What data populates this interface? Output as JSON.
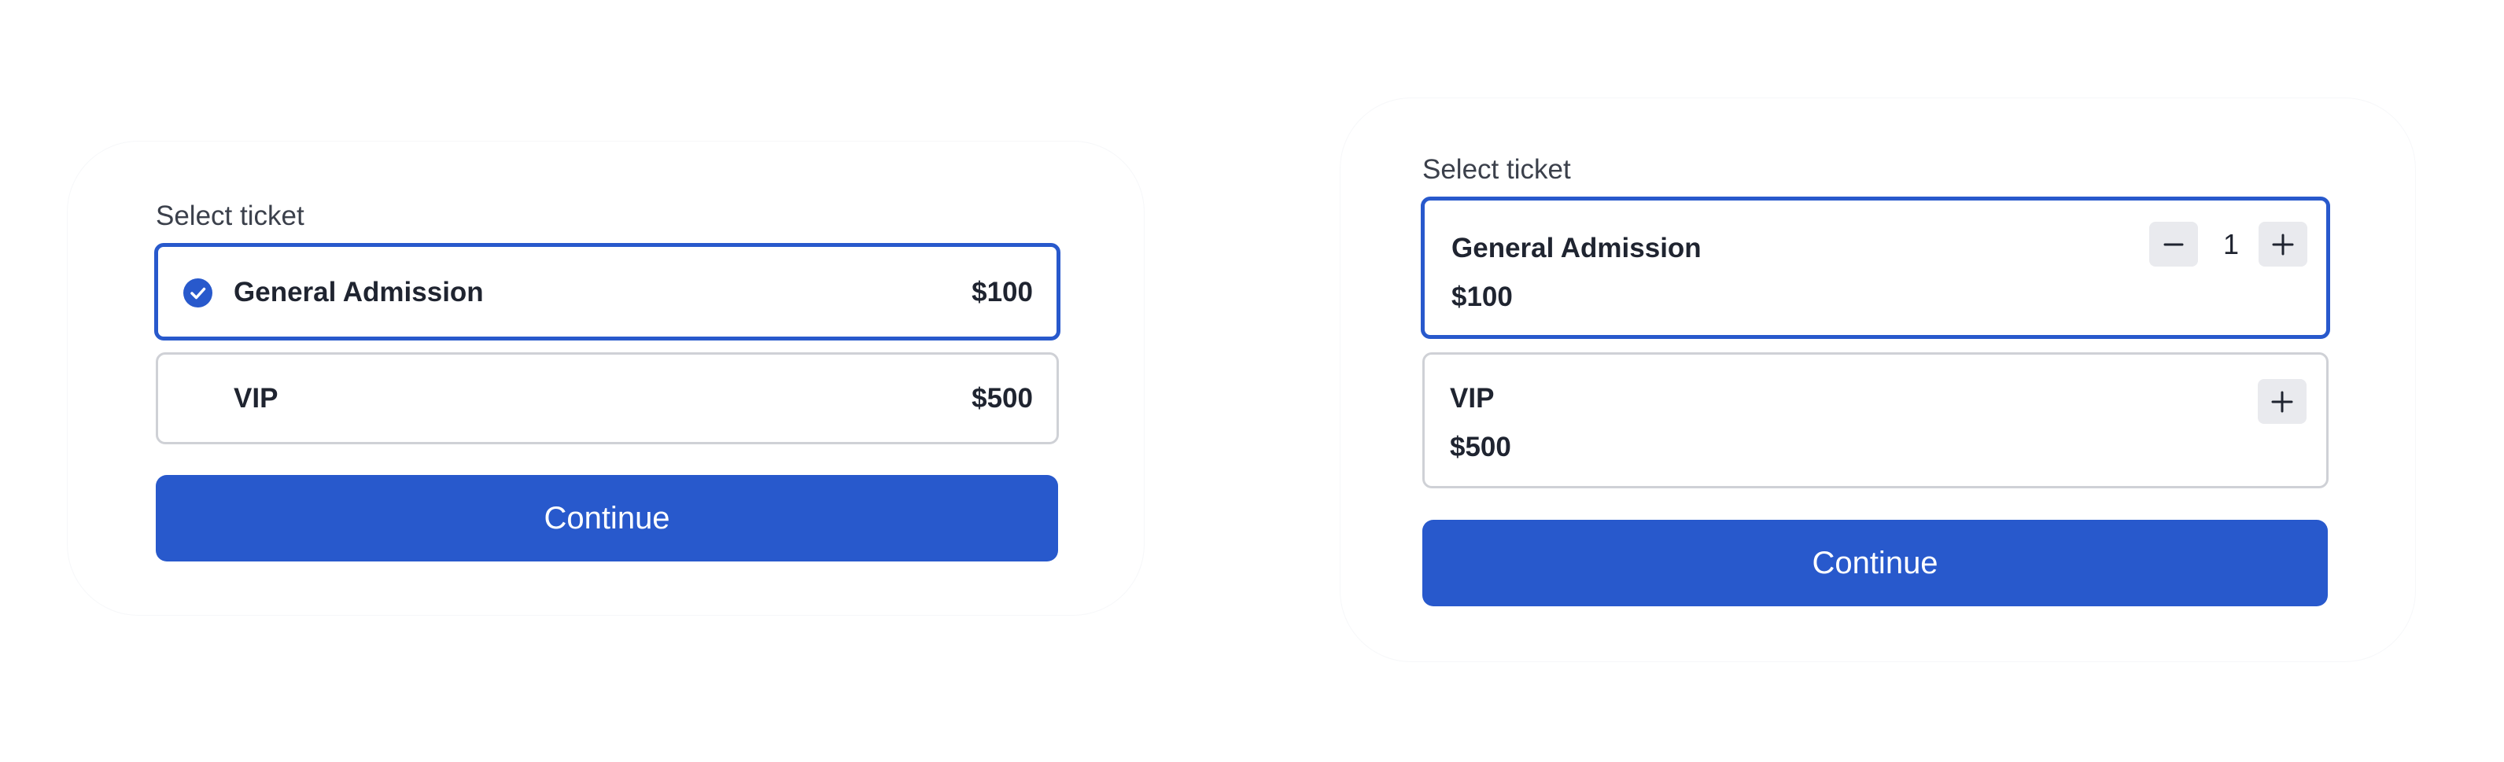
{
  "colors": {
    "accent": "#2859cc",
    "border": "#cfd1d6",
    "stepper_bg": "#e9eaee",
    "text": "#1f2430"
  },
  "variant_single": {
    "label": "Select ticket",
    "tickets": [
      {
        "name": "General Admission",
        "price": "$100",
        "selected": true,
        "icon": "check-circle-icon"
      },
      {
        "name": "VIP",
        "price": "$500",
        "selected": false
      }
    ],
    "continue_label": "Continue"
  },
  "variant_quantity": {
    "label": "Select ticket",
    "tickets": [
      {
        "name": "General Admission",
        "price": "$100",
        "selected": true,
        "quantity": "1",
        "icons": [
          "minus-icon",
          "plus-icon"
        ]
      },
      {
        "name": "VIP",
        "price": "$500",
        "selected": false,
        "icons": [
          "plus-icon"
        ]
      }
    ],
    "continue_label": "Continue"
  }
}
